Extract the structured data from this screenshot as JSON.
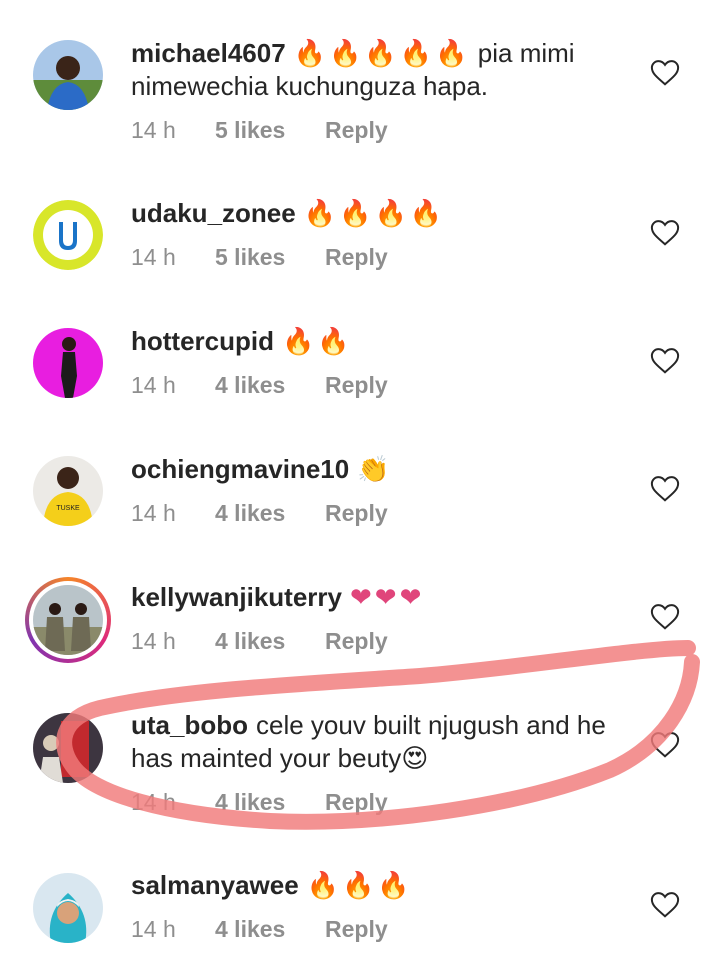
{
  "comments": [
    {
      "username": "michael4607",
      "emoji": "🔥🔥🔥🔥🔥",
      "text": "pia mimi nimewechia kuchunguza hapa.",
      "time": "14 h",
      "likes": "5 likes",
      "reply": "Reply",
      "avatar_icon": "profile-photo"
    },
    {
      "username": "udaku_zonee",
      "emoji": "🔥🔥🔥🔥",
      "text": "",
      "time": "14 h",
      "likes": "5 likes",
      "reply": "Reply",
      "avatar_icon": "u-logo"
    },
    {
      "username": "hottercupid",
      "emoji": "🔥🔥",
      "text": "",
      "time": "14 h",
      "likes": "4 likes",
      "reply": "Reply",
      "avatar_icon": "profile-photo"
    },
    {
      "username": "ochiengmavine10",
      "emoji": "👏",
      "text": "",
      "time": "14 h",
      "likes": "4 likes",
      "reply": "Reply",
      "avatar_icon": "profile-photo",
      "avatar_text": "TUSKE"
    },
    {
      "username": "kellywanjikuterry",
      "emoji": "❤❤❤",
      "text": "",
      "time": "14 h",
      "likes": "4 likes",
      "reply": "Reply",
      "avatar_icon": "story-ring-profile-photo"
    },
    {
      "username": "uta_bobo",
      "emoji": "",
      "text": "cele youv built njugush and he has mainted your beuty😍",
      "time": "14 h",
      "likes": "4 likes",
      "reply": "Reply",
      "avatar_icon": "profile-photo"
    },
    {
      "username": "salmanyawee",
      "emoji": "🔥🔥🔥",
      "text": "",
      "time": "14 h",
      "likes": "4 likes",
      "reply": "Reply",
      "avatar_icon": "profile-photo"
    }
  ],
  "colors": {
    "username": "#262626",
    "meta": "#8e8e8e",
    "annotation_stroke": "#f07a7a",
    "heart_outline": "#262626"
  },
  "icons": {
    "like": "heart-outline-icon"
  }
}
